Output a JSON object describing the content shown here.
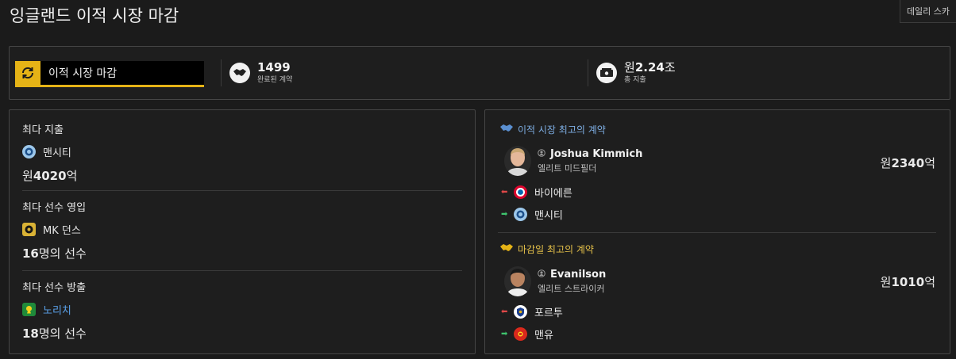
{
  "page": {
    "title": "잉글랜드 이적 시장 마감",
    "top_button": "데일리 스카"
  },
  "status": {
    "label": "이적 시장 마감",
    "icon": "refresh-icon"
  },
  "stats": [
    {
      "value": "1499",
      "label": "완료된 계약",
      "icon": "handshake-icon"
    },
    {
      "currency": "원",
      "value": "2.24",
      "unit": "조",
      "label": "총 지출",
      "icon": "cash-icon"
    }
  ],
  "records": {
    "spending": {
      "title": "최다 지출",
      "club": "맨시티",
      "currency": "원",
      "amount": "4020",
      "unit": "억"
    },
    "signings": {
      "title": "최다 선수 영입",
      "club": "MK 던스",
      "count": "16",
      "suffix": "명의 선수"
    },
    "departures": {
      "title": "최다 선수 방출",
      "club": "노리치",
      "count": "18",
      "suffix": "명의 선수"
    }
  },
  "best_deal": {
    "title": "이적 시장 최고의 계약",
    "player": "Joshua Kimmich",
    "position": "엘리트 미드필더",
    "fee_currency": "원",
    "fee_amount": "2340",
    "fee_unit": "억",
    "from_club": "바이에른",
    "to_club": "맨시티"
  },
  "deadline_deal": {
    "title": "마감일 최고의 계약",
    "player": "Evanilson",
    "position": "엘리트 스트라이커",
    "fee_currency": "원",
    "fee_amount": "1010",
    "fee_unit": "억",
    "from_club": "포르투",
    "to_club": "맨유"
  },
  "colors": {
    "accent": "#e5b316",
    "link": "#5aa0e8",
    "panel_border": "#464646",
    "background": "#1b1b1b"
  }
}
